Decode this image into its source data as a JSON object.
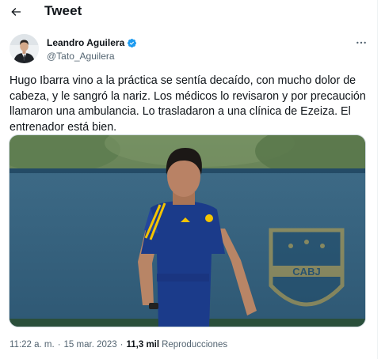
{
  "header": {
    "title": "Tweet",
    "back_icon": "arrow-left-icon"
  },
  "author": {
    "display_name": "Leandro Aguilera",
    "handle": "@Tato_Aguilera",
    "verified_icon": "verified-badge-icon",
    "verified_color": "#1d9bf0",
    "more_icon": "more-horizontal-icon"
  },
  "tweet": {
    "text": "Hugo Ibarra vino a la práctica se sentía decaído, con mucho dolor de cabeza, y le sangró la nariz. Los médicos lo revisaron y por precaución llamaron una ambulancia. Lo trasladaron a una clínica de Ezeiza. El entrenador está bien.",
    "time": "11:22 a. m.",
    "date": "15 mar. 2023",
    "views_count": "11,3 mil",
    "views_label": "Reproducciones"
  },
  "media": {
    "badge_text": "CABJ"
  },
  "colors": {
    "text": "#0f1419",
    "secondary": "#536471",
    "border": "#cfd9de",
    "accent": "#1d9bf0"
  }
}
